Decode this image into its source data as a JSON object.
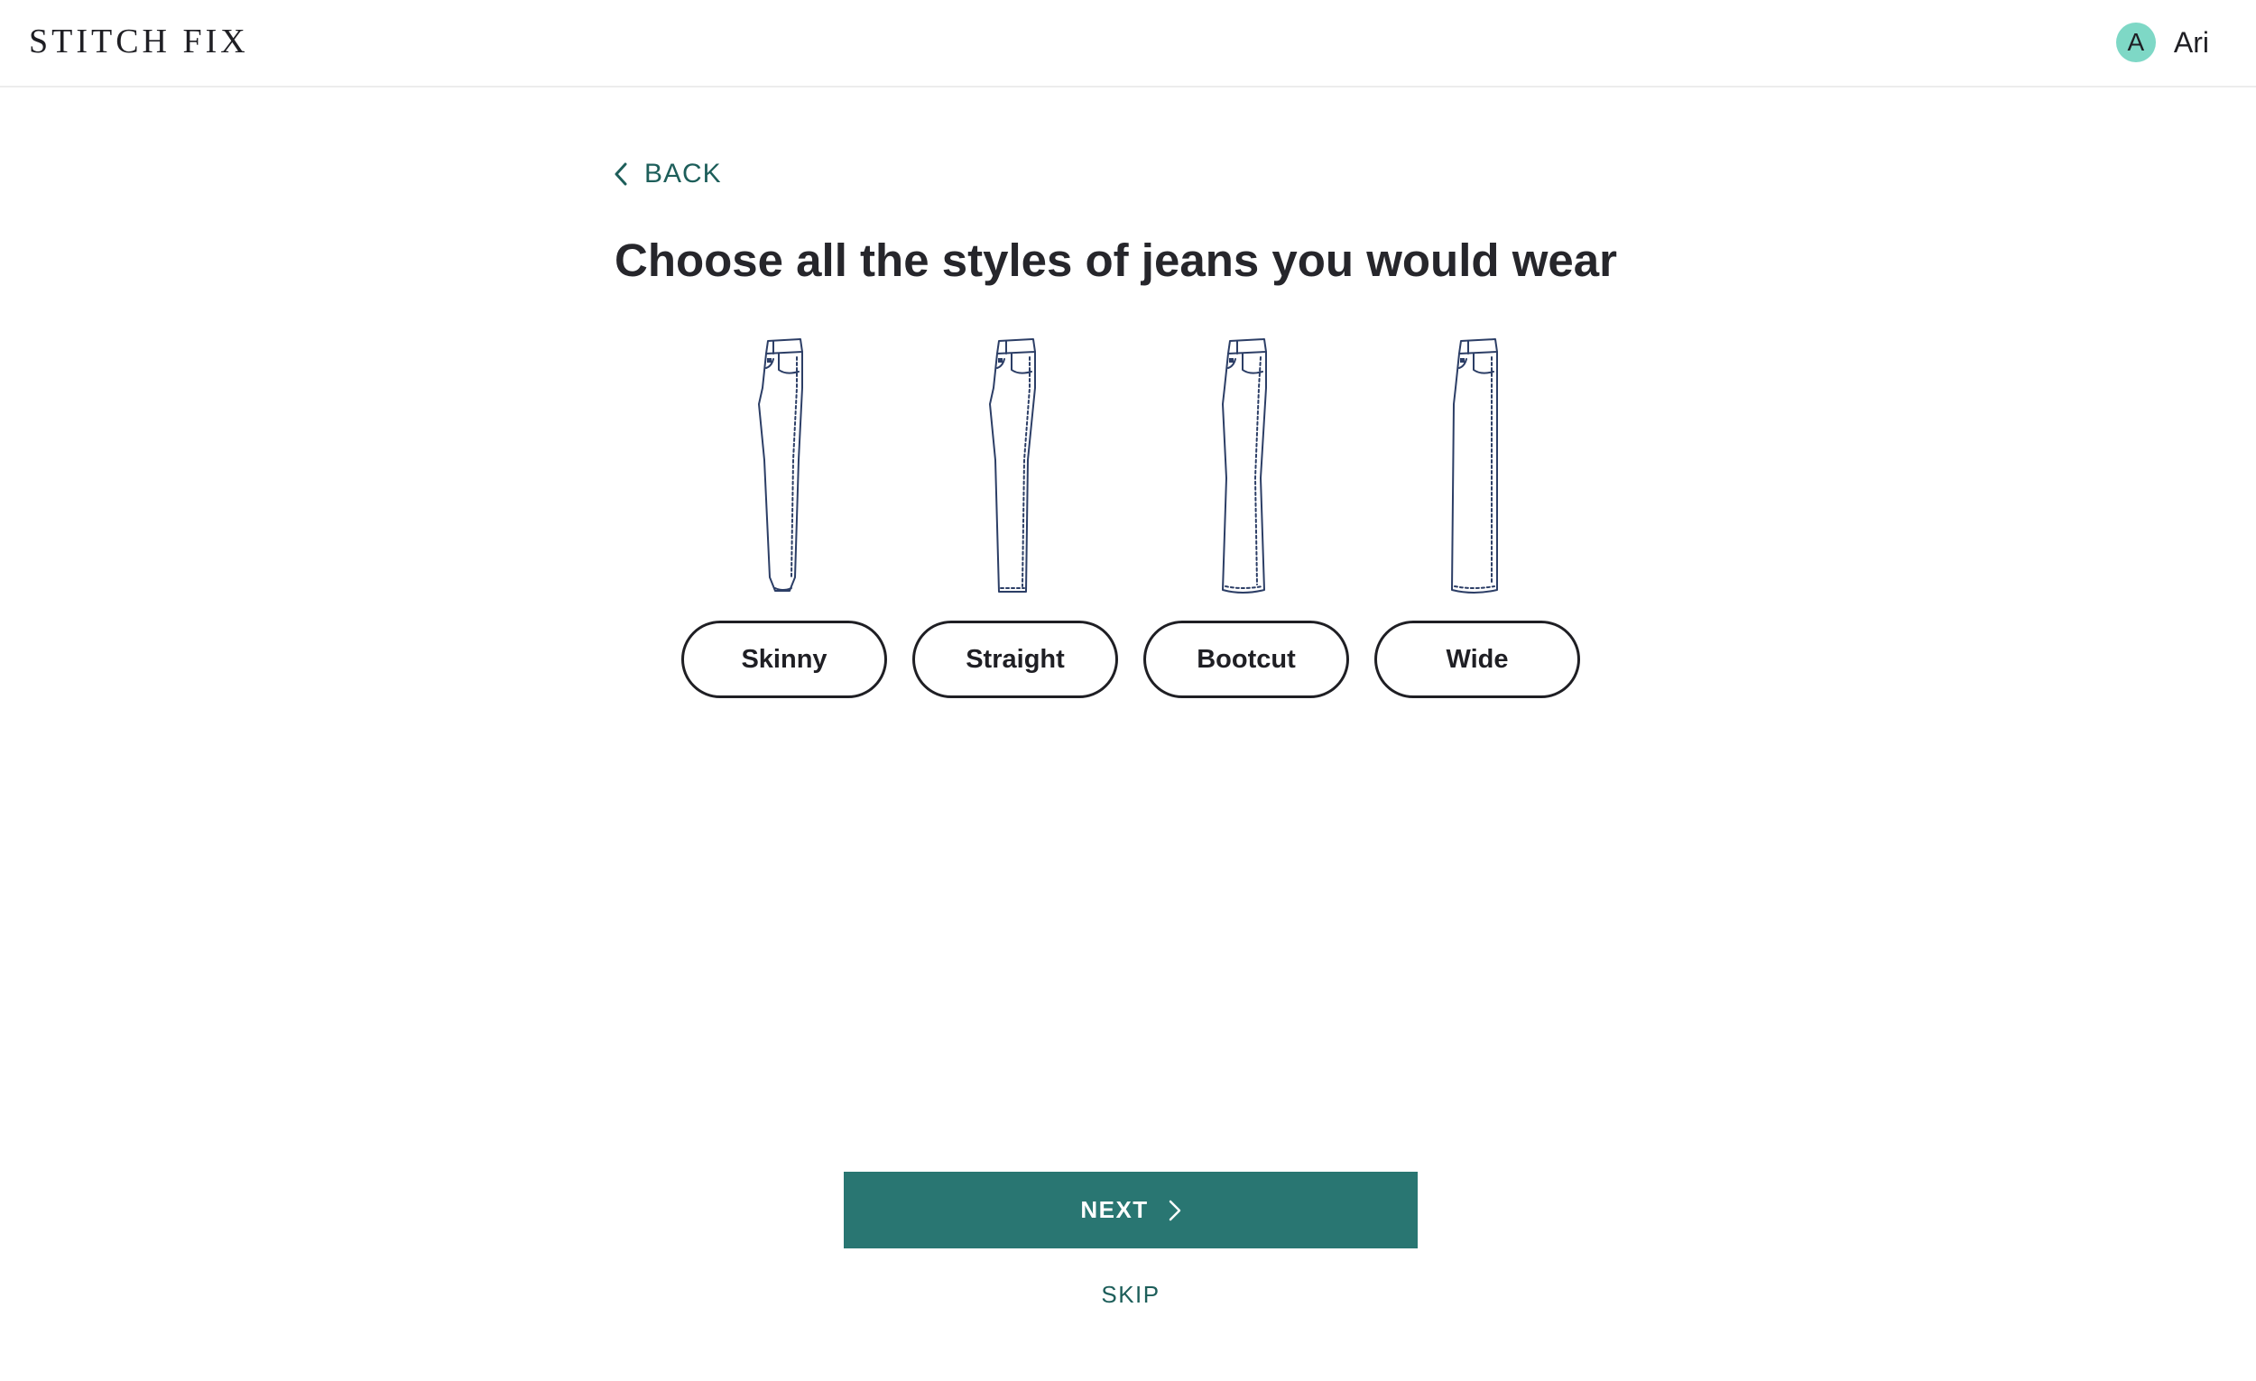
{
  "header": {
    "logo": "STITCH FIX",
    "user_initial": "A",
    "user_name": "Ari"
  },
  "nav": {
    "back_label": "BACK"
  },
  "question": {
    "title": "Choose all the styles of jeans you would wear"
  },
  "options": [
    {
      "label": "Skinny",
      "icon": "skinny-jeans-icon"
    },
    {
      "label": "Straight",
      "icon": "straight-jeans-icon"
    },
    {
      "label": "Bootcut",
      "icon": "bootcut-jeans-icon"
    },
    {
      "label": "Wide",
      "icon": "wide-jeans-icon"
    }
  ],
  "actions": {
    "next_label": "NEXT",
    "skip_label": "SKIP"
  },
  "colors": {
    "primary": "#297672",
    "link": "#1d5e5a",
    "avatar": "#7ed8c6",
    "text": "#26262b",
    "line_art": "#2c3e66"
  }
}
